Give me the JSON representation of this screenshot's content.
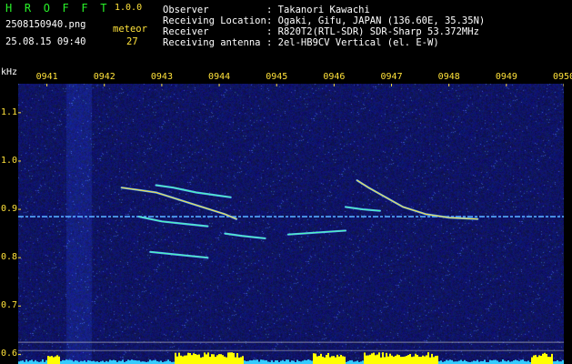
{
  "header": {
    "app_title": "H R O F F T",
    "version": "1.0.0",
    "filename": "2508150940.png",
    "datetime": "25.08.15 09:40",
    "meteor_label": "meteor",
    "meteor_count": "27",
    "observer_key": "Observer",
    "observer_value": ": Takanori Kawachi",
    "location_key": "Receiving Location",
    "location_value": ": Ogaki, Gifu, JAPAN (136.60E, 35.35N)",
    "receiver_key": "Receiver",
    "receiver_value": ": R820T2(RTL-SDR) SDR-Sharp 53.372MHz",
    "antenna_key": "Receiving antenna",
    "antenna_value": ": 2el-HB9CV Vertical (el. E-W)"
  },
  "chart_data": {
    "type": "heatmap",
    "xlabel": "",
    "ylabel": "kHz",
    "x_ticks": [
      "0941",
      "0942",
      "0943",
      "0944",
      "0945",
      "0946",
      "0947",
      "0948",
      "0949",
      "0950"
    ],
    "y_ticks": [
      "1.1",
      "1.0",
      "0.9",
      "0.8",
      "0.7",
      "0.6"
    ],
    "ylim": [
      0.58,
      1.16
    ],
    "xlim": [
      940.5,
      950.0
    ],
    "carrier_khz": 0.885,
    "background_color": "#0c0e63",
    "meteor_traces": [
      {
        "t": [
          942.3,
          942.9,
          943.3,
          943.7,
          944.1,
          944.3
        ],
        "f": [
          0.945,
          0.935,
          0.92,
          0.905,
          0.89,
          0.88
        ]
      },
      {
        "t": [
          942.9,
          943.2,
          943.6,
          943.9,
          944.2
        ],
        "f": [
          0.95,
          0.945,
          0.935,
          0.93,
          0.925
        ]
      },
      {
        "t": [
          942.6,
          943.0,
          943.4,
          943.8
        ],
        "f": [
          0.885,
          0.875,
          0.87,
          0.865
        ]
      },
      {
        "t": [
          944.1,
          944.4,
          944.8
        ],
        "f": [
          0.85,
          0.845,
          0.84
        ]
      },
      {
        "t": [
          946.4,
          946.6,
          946.9,
          947.2,
          947.6,
          948.0,
          948.5
        ],
        "f": [
          0.96,
          0.945,
          0.925,
          0.905,
          0.89,
          0.883,
          0.88
        ]
      },
      {
        "t": [
          946.2,
          946.5,
          946.8
        ],
        "f": [
          0.905,
          0.9,
          0.897
        ]
      },
      {
        "t": [
          942.8,
          943.3,
          943.8
        ],
        "f": [
          0.812,
          0.806,
          0.8
        ]
      },
      {
        "t": [
          945.2,
          945.7,
          946.2
        ],
        "f": [
          0.848,
          0.852,
          0.856
        ]
      }
    ],
    "colors": {
      "trace_hot": "#ffffff",
      "trace_mid": "#ffe23a",
      "trace_cool": "#4dffb0",
      "trace_base": "#55aaff",
      "histogram_high": "#ffff00",
      "histogram_low": "#33ccff"
    }
  }
}
